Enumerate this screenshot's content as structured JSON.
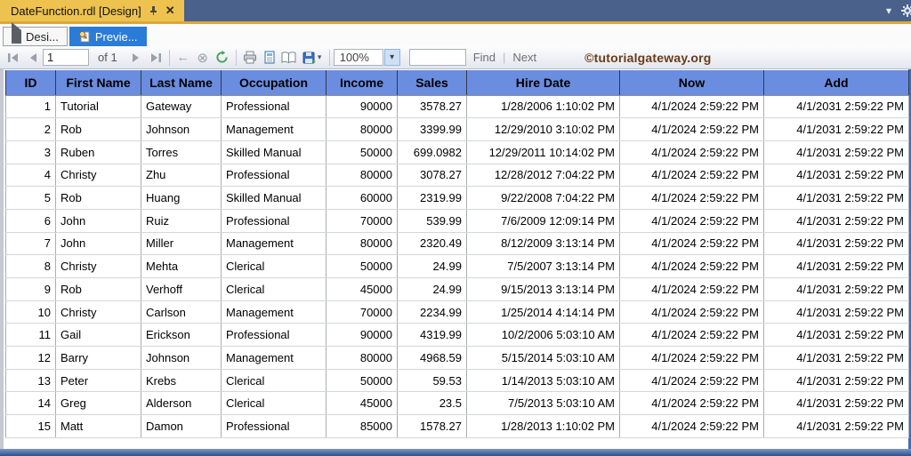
{
  "window": {
    "document_tab_title": "DateFunction.rdl [Design]",
    "close_glyph": "✕",
    "chevron_glyph": "▾"
  },
  "mode_tabs": {
    "design_label": "Desi...",
    "preview_label": "Previe..."
  },
  "toolbar": {
    "page_current": "1",
    "page_of_label": "of 1",
    "back_glyph": "←",
    "stop_glyph": "⊗",
    "zoom_value": "100%",
    "dropdown_glyph": "▾",
    "find_value": "",
    "find_label": "Find",
    "separator": "|",
    "next_label": "Next",
    "watermark": "©tutorialgateway.org"
  },
  "colors": {
    "header_blue": "#6b8de0",
    "tab_gold": "#edc24f",
    "strip_blue": "#4a618c",
    "selected_tab_blue": "#2b7bd8",
    "watermark_brown": "#6b3a16",
    "window_edge_blue": "#2e4e8e"
  },
  "table": {
    "columns": [
      "ID",
      "First Name",
      "Last Name",
      "Occupation",
      "Income",
      "Sales",
      "Hire Date",
      "Now",
      "Add"
    ],
    "rows": [
      [
        "1",
        "Tutorial",
        "Gateway",
        "Professional",
        "90000",
        "3578.27",
        "1/28/2006 1:10:02 PM",
        "4/1/2024 2:59:22 PM",
        "4/1/2031 2:59:22 PM"
      ],
      [
        "2",
        "Rob",
        "Johnson",
        "Management",
        "80000",
        "3399.99",
        "12/29/2010 3:10:02 PM",
        "4/1/2024 2:59:22 PM",
        "4/1/2031 2:59:22 PM"
      ],
      [
        "3",
        "Ruben",
        "Torres",
        "Skilled Manual",
        "50000",
        "699.0982",
        "12/29/2011 10:14:02 PM",
        "4/1/2024 2:59:22 PM",
        "4/1/2031 2:59:22 PM"
      ],
      [
        "4",
        "Christy",
        "Zhu",
        "Professional",
        "80000",
        "3078.27",
        "12/28/2012 7:04:22 PM",
        "4/1/2024 2:59:22 PM",
        "4/1/2031 2:59:22 PM"
      ],
      [
        "5",
        "Rob",
        "Huang",
        "Skilled Manual",
        "60000",
        "2319.99",
        "9/22/2008 7:04:22 PM",
        "4/1/2024 2:59:22 PM",
        "4/1/2031 2:59:22 PM"
      ],
      [
        "6",
        "John",
        "Ruiz",
        "Professional",
        "70000",
        "539.99",
        "7/6/2009 12:09:14 PM",
        "4/1/2024 2:59:22 PM",
        "4/1/2031 2:59:22 PM"
      ],
      [
        "7",
        "John",
        "Miller",
        "Management",
        "80000",
        "2320.49",
        "8/12/2009 3:13:14 PM",
        "4/1/2024 2:59:22 PM",
        "4/1/2031 2:59:22 PM"
      ],
      [
        "8",
        "Christy",
        "Mehta",
        "Clerical",
        "50000",
        "24.99",
        "7/5/2007 3:13:14 PM",
        "4/1/2024 2:59:22 PM",
        "4/1/2031 2:59:22 PM"
      ],
      [
        "9",
        "Rob",
        "Verhoff",
        "Clerical",
        "45000",
        "24.99",
        "9/15/2013 3:13:14 PM",
        "4/1/2024 2:59:22 PM",
        "4/1/2031 2:59:22 PM"
      ],
      [
        "10",
        "Christy",
        "Carlson",
        "Management",
        "70000",
        "2234.99",
        "1/25/2014 4:14:14 PM",
        "4/1/2024 2:59:22 PM",
        "4/1/2031 2:59:22 PM"
      ],
      [
        "11",
        "Gail",
        "Erickson",
        "Professional",
        "90000",
        "4319.99",
        "10/2/2006 5:03:10 AM",
        "4/1/2024 2:59:22 PM",
        "4/1/2031 2:59:22 PM"
      ],
      [
        "12",
        "Barry",
        "Johnson",
        "Management",
        "80000",
        "4968.59",
        "5/15/2014 5:03:10 AM",
        "4/1/2024 2:59:22 PM",
        "4/1/2031 2:59:22 PM"
      ],
      [
        "13",
        "Peter",
        "Krebs",
        "Clerical",
        "50000",
        "59.53",
        "1/14/2013 5:03:10 AM",
        "4/1/2024 2:59:22 PM",
        "4/1/2031 2:59:22 PM"
      ],
      [
        "14",
        "Greg",
        "Alderson",
        "Clerical",
        "45000",
        "23.5",
        "7/5/2013 5:03:10 AM",
        "4/1/2024 2:59:22 PM",
        "4/1/2031 2:59:22 PM"
      ],
      [
        "15",
        "Matt",
        "Damon",
        "Professional",
        "85000",
        "1578.27",
        "1/28/2013 1:10:02 PM",
        "4/1/2024 2:59:22 PM",
        "4/1/2031 2:59:22 PM"
      ]
    ]
  }
}
